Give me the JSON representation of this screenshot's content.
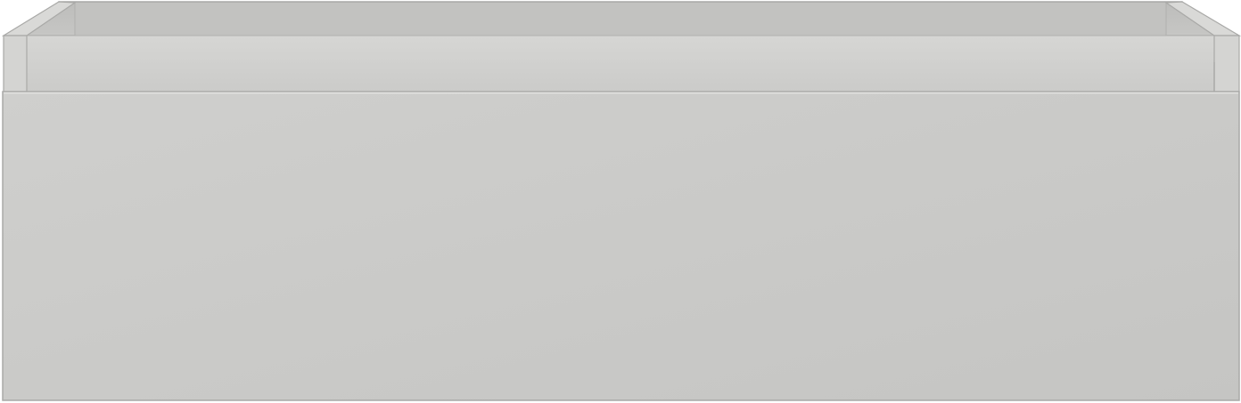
{
  "object": {
    "kind": "open drawer (front view)",
    "colors": {
      "front_panel": "#cbcbc9",
      "front_panel_shade": "#c6c6c4",
      "inner_side_panel": "#d2d2d0",
      "inner_back_wall": "#c0c0be",
      "outline": "#a9a9a7",
      "edge_highlight": "#e4e4e2",
      "background": "#ffffff"
    }
  }
}
